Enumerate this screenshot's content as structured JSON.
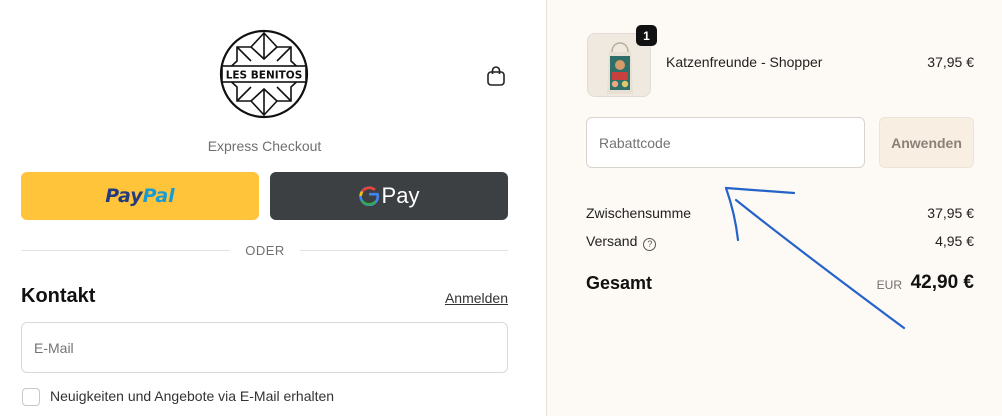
{
  "header": {
    "brand": "LES BENITOS",
    "cart_icon": "shopping-bag-icon"
  },
  "express": {
    "label": "Express Checkout",
    "paypal_a": "Pay",
    "paypal_b": "Pal",
    "gpay_label": "Pay",
    "divider": "ODER"
  },
  "contact": {
    "title": "Kontakt",
    "login_link": "Anmelden",
    "email_placeholder": "E-Mail",
    "newsletter_label": "Neuigkeiten und Angebote via E-Mail erhalten"
  },
  "cart": {
    "quantity": "1",
    "product_name": "Katzenfreunde - Shopper",
    "product_price": "37,95 €"
  },
  "discount": {
    "placeholder": "Rabattcode",
    "apply_label": "Anwenden"
  },
  "summary": {
    "subtotal_label": "Zwischensumme",
    "subtotal_value": "37,95 €",
    "shipping_label": "Versand",
    "shipping_value": "4,95 €",
    "total_label": "Gesamt",
    "currency": "EUR",
    "total_value": "42,90 €"
  },
  "colors": {
    "paypal_bg": "#ffc439",
    "gpay_bg": "#3c4043",
    "summary_bg": "#fdf9f4",
    "annotation_arrow": "#2563c9"
  }
}
